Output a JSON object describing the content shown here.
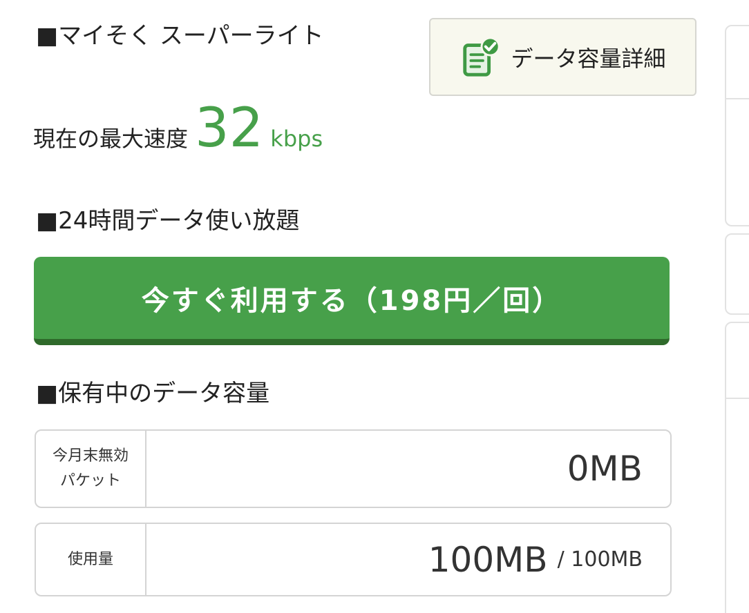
{
  "plan": {
    "title": "■マイそく スーパーライト"
  },
  "detail_button": {
    "label": "データ容量詳細",
    "icon": "document-check-icon"
  },
  "speed": {
    "label": "現在の最大速度",
    "value": "32",
    "unit": "kbps"
  },
  "unlimited": {
    "title": "■24時間データ使い放題",
    "button_label": "今すぐ利用する（198円／回）"
  },
  "capacity": {
    "title": "■保有中のデータ容量",
    "invalid_packet": {
      "label_line1": "今月末無効",
      "label_line2": "パケット",
      "value": "0MB"
    },
    "usage": {
      "label": "使用量",
      "value": "100MB",
      "total": "/ 100MB"
    }
  },
  "colors": {
    "accent_green": "#47a04a",
    "button_shadow_green": "#2f6a2b",
    "detail_button_bg": "#f8f8ee"
  }
}
